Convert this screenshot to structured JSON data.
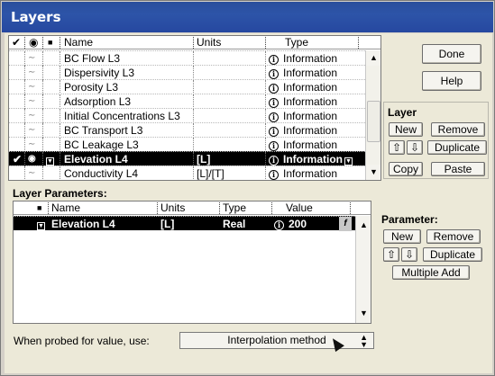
{
  "window": {
    "title": "Layers"
  },
  "layers_table": {
    "headers": {
      "check": "✔",
      "eye": "◉",
      "lock": "▲",
      "name": "Name",
      "units": "Units",
      "type": "Type"
    },
    "rows": [
      {
        "name": "BC Flow L3",
        "units": "",
        "type": "Information",
        "selected": false
      },
      {
        "name": "Dispersivity L3",
        "units": "",
        "type": "Information",
        "selected": false
      },
      {
        "name": "Porosity L3",
        "units": "",
        "type": "Information",
        "selected": false
      },
      {
        "name": "Adsorption L3",
        "units": "",
        "type": "Information",
        "selected": false
      },
      {
        "name": "Initial Concentrations L3",
        "units": "",
        "type": "Information",
        "selected": false
      },
      {
        "name": "BC Transport L3",
        "units": "",
        "type": "Information",
        "selected": false
      },
      {
        "name": "BC Leakage L3",
        "units": "",
        "type": "Information",
        "selected": false
      },
      {
        "name": "Elevation L4",
        "units": "[L]",
        "type": "Information",
        "selected": true
      },
      {
        "name": "Conductivity L4",
        "units": "[L]/[T]",
        "type": "Information",
        "selected": false
      }
    ],
    "eye_glyph": "◉",
    "check_glyph": "✔",
    "info_glyph": "i"
  },
  "buttons": {
    "done": "Done",
    "help": "Help"
  },
  "layer_panel": {
    "title": "Layer",
    "new": "New",
    "remove": "Remove",
    "up": "⇧",
    "down": "⇩",
    "duplicate": "Duplicate",
    "copy": "Copy",
    "paste": "Paste"
  },
  "params_section": {
    "title": "Layer Parameters:",
    "headers": {
      "name": "Name",
      "units": "Units",
      "type": "Type",
      "value": "Value"
    },
    "rows": [
      {
        "name": "Elevation L4",
        "units": "[L]",
        "type": "Real",
        "value": "200",
        "selected": true
      }
    ]
  },
  "parameter_panel": {
    "title": "Parameter:",
    "new": "New",
    "remove": "Remove",
    "up": "⇧",
    "down": "⇩",
    "duplicate": "Duplicate",
    "multiple_add": "Multiple Add"
  },
  "probe": {
    "label": "When probed for value, use:",
    "selected": "Interpolation method"
  },
  "colors": {
    "titlebar": "#2a4e9c",
    "selection": "#000000",
    "face": "#ece9d8"
  }
}
